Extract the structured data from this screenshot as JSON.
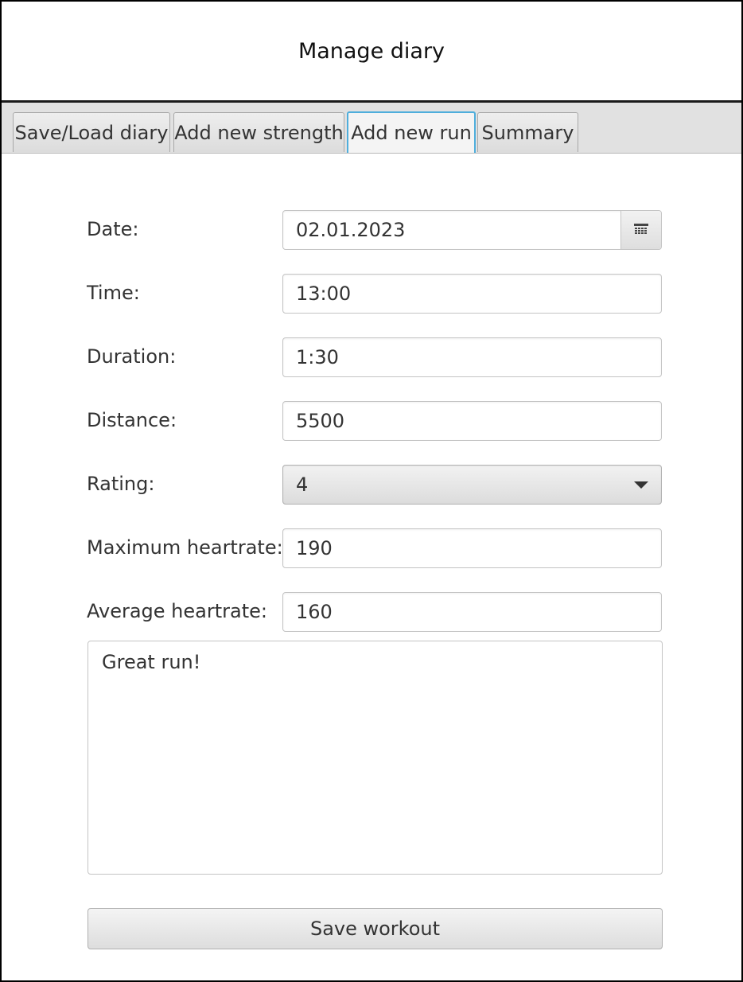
{
  "header": {
    "title": "Manage diary"
  },
  "tabs": [
    {
      "label": "Save/Load diary",
      "selected": false
    },
    {
      "label": "Add new strength",
      "selected": false
    },
    {
      "label": "Add new run",
      "selected": true
    },
    {
      "label": "Summary",
      "selected": false
    }
  ],
  "form": {
    "date": {
      "label": "Date:",
      "value": "02.01.2023",
      "button_icon": "calendar-icon"
    },
    "time": {
      "label": "Time:",
      "value": "13:00"
    },
    "duration": {
      "label": "Duration:",
      "value": "1:30"
    },
    "distance": {
      "label": "Distance:",
      "value": "5500"
    },
    "rating": {
      "label": "Rating:",
      "value": "4",
      "icon": "chevron-down-icon"
    },
    "max_heartrate": {
      "label": "Maximum heartrate:",
      "value": "190"
    },
    "avg_heartrate": {
      "label": "Average heartrate:",
      "value": "160"
    },
    "notes": {
      "value": "Great run!"
    }
  },
  "actions": {
    "save_label": "Save workout"
  },
  "colors": {
    "tab_selected_border": "#4faedc",
    "tabbar_background": "#e1e1e1",
    "header_rule": "#1a1a1a"
  }
}
